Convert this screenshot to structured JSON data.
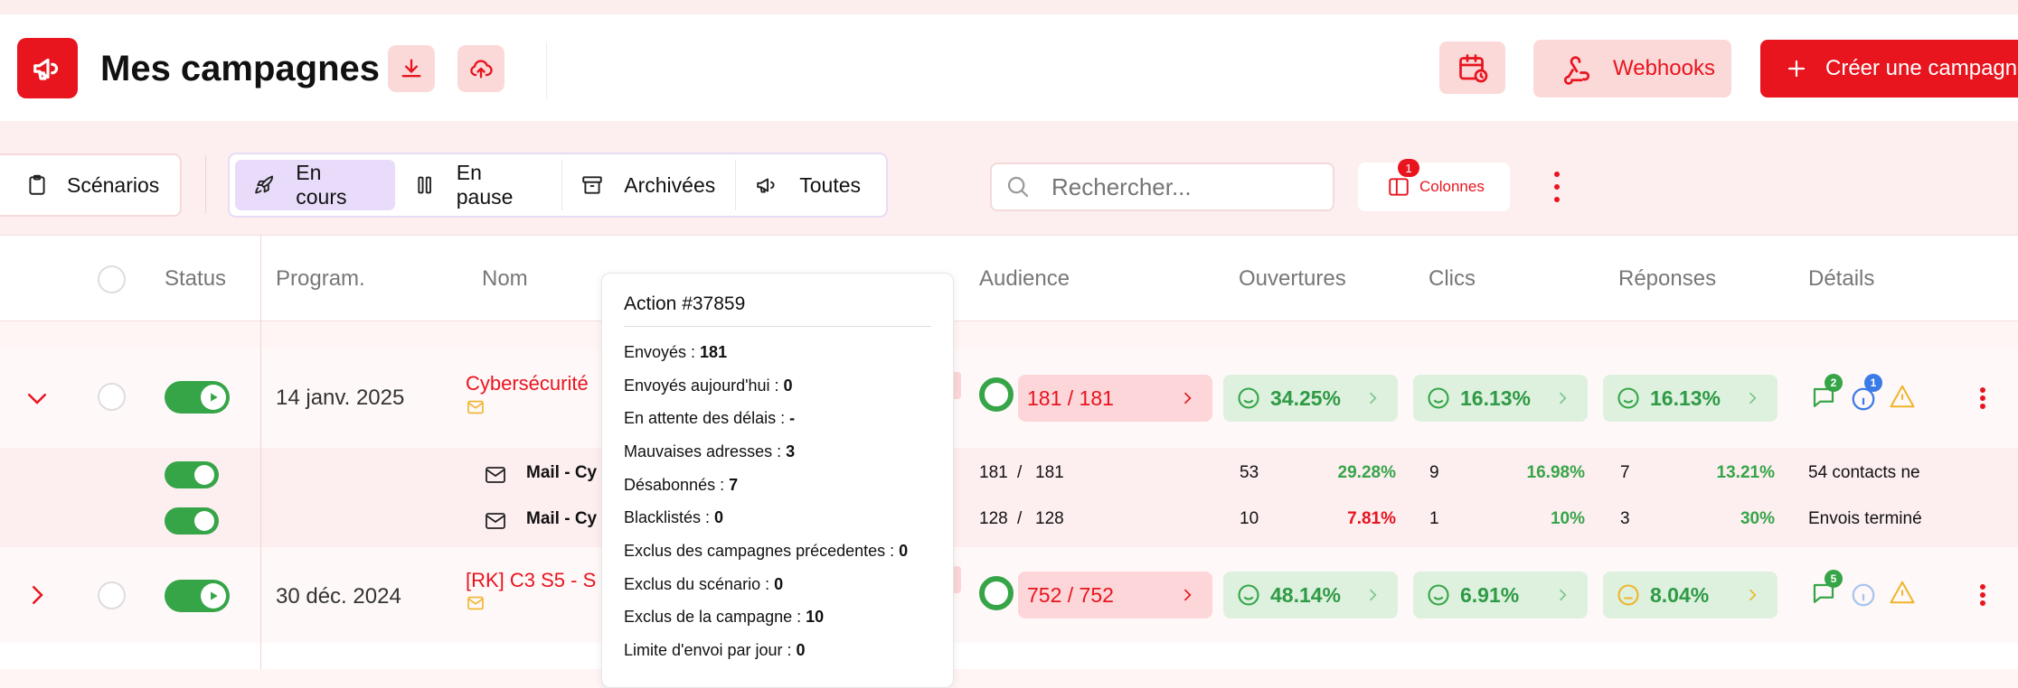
{
  "header": {
    "title": "Mes campagnes",
    "webhooks_label": "Webhooks",
    "create_label": "Créer une campagne"
  },
  "toolbar": {
    "scenarios_label": "Scénarios",
    "filters": [
      {
        "label": "En cours",
        "active": true
      },
      {
        "label": "En pause",
        "active": false
      },
      {
        "label": "Archivées",
        "active": false
      },
      {
        "label": "Toutes",
        "active": false
      }
    ],
    "search_placeholder": "Rechercher...",
    "columns_label": "Colonnes",
    "columns_badge": "1"
  },
  "table": {
    "headers": {
      "status": "Status",
      "program": "Program.",
      "name": "Nom",
      "audience": "Audience",
      "opens": "Ouvertures",
      "clicks": "Clics",
      "replies": "Réponses",
      "details": "Détails"
    },
    "rows": [
      {
        "date": "14 janv. 2025",
        "name": "Cybersécurité",
        "audience": "181 / 181",
        "opens": "34.25%",
        "clicks": "16.13%",
        "replies": "16.13%",
        "comments_badge": "2",
        "info_badge": "1",
        "sub_rows": [
          {
            "name": "Mail - Cy",
            "sent": "181",
            "sep": "/",
            "total": "181",
            "opens": "53",
            "opens_pct": "29.28%",
            "clicks": "9",
            "clicks_pct": "16.98%",
            "replies": "7",
            "replies_pct": "13.21%",
            "detail": "54 contacts ne"
          },
          {
            "name": "Mail - Cy",
            "sent": "128",
            "sep": "/",
            "total": "128",
            "opens": "10",
            "opens_pct": "7.81%",
            "clicks": "1",
            "clicks_pct": "10%",
            "replies": "3",
            "replies_pct": "30%",
            "detail": "Envois terminé"
          }
        ]
      },
      {
        "date": "30 déc. 2024",
        "name": "[RK] C3 S5 - S",
        "audience": "752 / 752",
        "opens": "48.14%",
        "clicks": "6.91%",
        "replies": "8.04%",
        "comments_badge": "5"
      }
    ]
  },
  "tooltip": {
    "title": "Action #37859",
    "lines": [
      {
        "label": "Envoyés :",
        "value": "181"
      },
      {
        "label": "Envoyés aujourd'hui :",
        "value": "0"
      },
      {
        "label": "En attente des délais :",
        "value": "-"
      },
      {
        "label": "Mauvaises adresses :",
        "value": "3"
      },
      {
        "label": "Désabonnés :",
        "value": "7"
      },
      {
        "label": "Blacklistés :",
        "value": "0"
      },
      {
        "label": "Exclus des campagnes précedentes :",
        "value": "0"
      },
      {
        "label": "Exclus du scénario :",
        "value": "0"
      },
      {
        "label": "Exclus de la campagne :",
        "value": "10"
      },
      {
        "label": "Limite d'envoi par jour :",
        "value": "0"
      }
    ]
  },
  "colors": {
    "accent": "#e8141e",
    "green": "#36a548",
    "pink": "#fbd9d9",
    "active_filter": "#e9dcfb"
  },
  "icons": {
    "logo": "megaphone-icon",
    "download": "download-icon",
    "upload": "cloud-upload-icon",
    "calendar": "calendar-clock-icon",
    "webhooks": "webhook-icon",
    "create": "plus-icon"
  }
}
